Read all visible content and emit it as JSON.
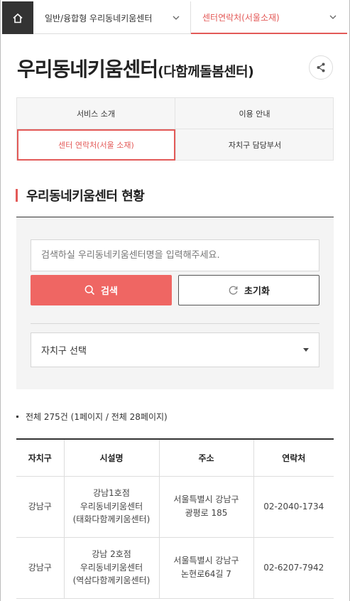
{
  "nav": {
    "home_icon": "home-icon",
    "menu1_label": "일반/융합형 우리동네키움센터",
    "menu2_label": "센터연락처(서울소재)"
  },
  "header": {
    "title": "우리동네키움센터",
    "subtitle": "(다함께돌봄센터)",
    "share_icon": "share-icon"
  },
  "tabs": [
    {
      "label": "서비스 소개",
      "active": false
    },
    {
      "label": "이용 안내",
      "active": false
    },
    {
      "label": "센터 연락처(서울 소재)",
      "active": true
    },
    {
      "label": "자치구 담당부서",
      "active": false
    }
  ],
  "section": {
    "title": "우리동네키움센터 현황"
  },
  "search": {
    "placeholder": "검색하실 우리동네키움센터명을 입력해주세요.",
    "search_label": "검색",
    "reset_label": "초기화",
    "district_select": "자치구 선택"
  },
  "total": {
    "text": "전체 275건 (1페이지 / 전체 28페이지)"
  },
  "table": {
    "headers": [
      "자치구",
      "시설명",
      "주소",
      "연락처"
    ],
    "rows": [
      {
        "district": "강남구",
        "name": "강남1호점 우리동네키움센터(태화다함께키움센터)",
        "address": "서울특별시 강남구 광평로 185",
        "phone": "02-2040-1734"
      },
      {
        "district": "강남구",
        "name": "강남 2호점 우리동네키움센터 (역삼다함께키움센터)",
        "address": "서울특별시 강남구 논현로64길 7",
        "phone": "02-6207-7942"
      }
    ]
  },
  "colors": {
    "accent": "#e35a58",
    "search_button": "#ef6663",
    "home_bg": "#333333"
  }
}
